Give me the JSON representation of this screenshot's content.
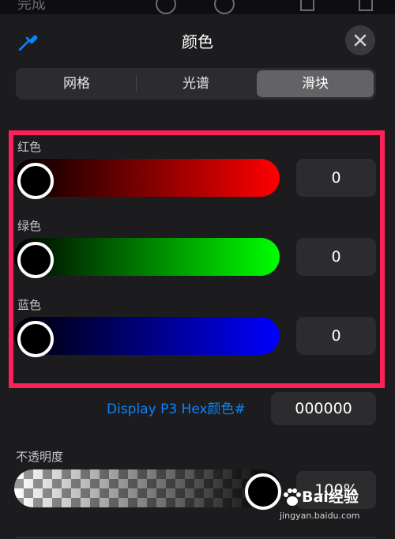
{
  "background_strip": {
    "partial_label": "完成",
    "icons": [
      "undo-icon",
      "redo-icon",
      "trash-icon",
      "share-icon"
    ]
  },
  "header": {
    "title": "颜色",
    "eyedropper_icon": "eyedropper-icon",
    "close_icon": "close-icon"
  },
  "tabs": [
    {
      "label": "网格",
      "active": false
    },
    {
      "label": "光谱",
      "active": false
    },
    {
      "label": "滑块",
      "active": true
    }
  ],
  "sliders": [
    {
      "label": "红色",
      "value": "0",
      "color": "#ff0000"
    },
    {
      "label": "绿色",
      "value": "0",
      "color": "#00ff00"
    },
    {
      "label": "蓝色",
      "value": "0",
      "color": "#0000ff"
    }
  ],
  "hex": {
    "label": "Display P3 Hex颜色#",
    "value": "000000"
  },
  "opacity": {
    "label": "不透明度",
    "value": "100%",
    "level": 1.0
  },
  "watermark": {
    "brand": "Bai经验",
    "url": "jingyan.baidu.com"
  },
  "colors": {
    "accent": "#0a84ff",
    "highlight_border": "#ff1f5a",
    "panel_bg": "#1c1c1e"
  }
}
